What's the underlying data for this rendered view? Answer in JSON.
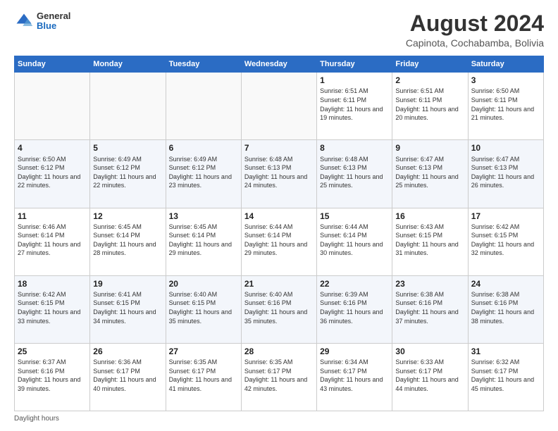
{
  "header": {
    "logo_general": "General",
    "logo_blue": "Blue",
    "month_title": "August 2024",
    "subtitle": "Capinota, Cochabamba, Bolivia"
  },
  "days_of_week": [
    "Sunday",
    "Monday",
    "Tuesday",
    "Wednesday",
    "Thursday",
    "Friday",
    "Saturday"
  ],
  "weeks": [
    [
      {
        "day": "",
        "detail": ""
      },
      {
        "day": "",
        "detail": ""
      },
      {
        "day": "",
        "detail": ""
      },
      {
        "day": "",
        "detail": ""
      },
      {
        "day": "1",
        "detail": "Sunrise: 6:51 AM\nSunset: 6:11 PM\nDaylight: 11 hours and 19 minutes."
      },
      {
        "day": "2",
        "detail": "Sunrise: 6:51 AM\nSunset: 6:11 PM\nDaylight: 11 hours and 20 minutes."
      },
      {
        "day": "3",
        "detail": "Sunrise: 6:50 AM\nSunset: 6:11 PM\nDaylight: 11 hours and 21 minutes."
      }
    ],
    [
      {
        "day": "4",
        "detail": "Sunrise: 6:50 AM\nSunset: 6:12 PM\nDaylight: 11 hours and 22 minutes."
      },
      {
        "day": "5",
        "detail": "Sunrise: 6:49 AM\nSunset: 6:12 PM\nDaylight: 11 hours and 22 minutes."
      },
      {
        "day": "6",
        "detail": "Sunrise: 6:49 AM\nSunset: 6:12 PM\nDaylight: 11 hours and 23 minutes."
      },
      {
        "day": "7",
        "detail": "Sunrise: 6:48 AM\nSunset: 6:13 PM\nDaylight: 11 hours and 24 minutes."
      },
      {
        "day": "8",
        "detail": "Sunrise: 6:48 AM\nSunset: 6:13 PM\nDaylight: 11 hours and 25 minutes."
      },
      {
        "day": "9",
        "detail": "Sunrise: 6:47 AM\nSunset: 6:13 PM\nDaylight: 11 hours and 25 minutes."
      },
      {
        "day": "10",
        "detail": "Sunrise: 6:47 AM\nSunset: 6:13 PM\nDaylight: 11 hours and 26 minutes."
      }
    ],
    [
      {
        "day": "11",
        "detail": "Sunrise: 6:46 AM\nSunset: 6:14 PM\nDaylight: 11 hours and 27 minutes."
      },
      {
        "day": "12",
        "detail": "Sunrise: 6:45 AM\nSunset: 6:14 PM\nDaylight: 11 hours and 28 minutes."
      },
      {
        "day": "13",
        "detail": "Sunrise: 6:45 AM\nSunset: 6:14 PM\nDaylight: 11 hours and 29 minutes."
      },
      {
        "day": "14",
        "detail": "Sunrise: 6:44 AM\nSunset: 6:14 PM\nDaylight: 11 hours and 29 minutes."
      },
      {
        "day": "15",
        "detail": "Sunrise: 6:44 AM\nSunset: 6:14 PM\nDaylight: 11 hours and 30 minutes."
      },
      {
        "day": "16",
        "detail": "Sunrise: 6:43 AM\nSunset: 6:15 PM\nDaylight: 11 hours and 31 minutes."
      },
      {
        "day": "17",
        "detail": "Sunrise: 6:42 AM\nSunset: 6:15 PM\nDaylight: 11 hours and 32 minutes."
      }
    ],
    [
      {
        "day": "18",
        "detail": "Sunrise: 6:42 AM\nSunset: 6:15 PM\nDaylight: 11 hours and 33 minutes."
      },
      {
        "day": "19",
        "detail": "Sunrise: 6:41 AM\nSunset: 6:15 PM\nDaylight: 11 hours and 34 minutes."
      },
      {
        "day": "20",
        "detail": "Sunrise: 6:40 AM\nSunset: 6:15 PM\nDaylight: 11 hours and 35 minutes."
      },
      {
        "day": "21",
        "detail": "Sunrise: 6:40 AM\nSunset: 6:16 PM\nDaylight: 11 hours and 35 minutes."
      },
      {
        "day": "22",
        "detail": "Sunrise: 6:39 AM\nSunset: 6:16 PM\nDaylight: 11 hours and 36 minutes."
      },
      {
        "day": "23",
        "detail": "Sunrise: 6:38 AM\nSunset: 6:16 PM\nDaylight: 11 hours and 37 minutes."
      },
      {
        "day": "24",
        "detail": "Sunrise: 6:38 AM\nSunset: 6:16 PM\nDaylight: 11 hours and 38 minutes."
      }
    ],
    [
      {
        "day": "25",
        "detail": "Sunrise: 6:37 AM\nSunset: 6:16 PM\nDaylight: 11 hours and 39 minutes."
      },
      {
        "day": "26",
        "detail": "Sunrise: 6:36 AM\nSunset: 6:17 PM\nDaylight: 11 hours and 40 minutes."
      },
      {
        "day": "27",
        "detail": "Sunrise: 6:35 AM\nSunset: 6:17 PM\nDaylight: 11 hours and 41 minutes."
      },
      {
        "day": "28",
        "detail": "Sunrise: 6:35 AM\nSunset: 6:17 PM\nDaylight: 11 hours and 42 minutes."
      },
      {
        "day": "29",
        "detail": "Sunrise: 6:34 AM\nSunset: 6:17 PM\nDaylight: 11 hours and 43 minutes."
      },
      {
        "day": "30",
        "detail": "Sunrise: 6:33 AM\nSunset: 6:17 PM\nDaylight: 11 hours and 44 minutes."
      },
      {
        "day": "31",
        "detail": "Sunrise: 6:32 AM\nSunset: 6:17 PM\nDaylight: 11 hours and 45 minutes."
      }
    ]
  ],
  "footer": {
    "note": "Daylight hours"
  }
}
